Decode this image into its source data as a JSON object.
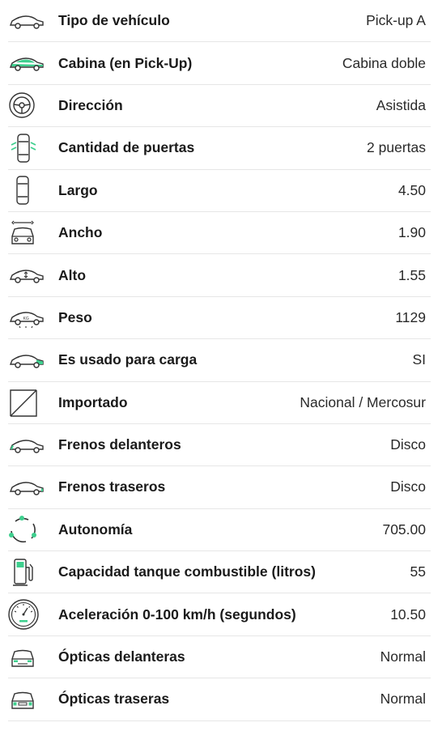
{
  "accent_color": "#3ecf8e",
  "specs": [
    {
      "icon": "car-side-icon",
      "label": "Tipo de vehículo",
      "value": "Pick-up A"
    },
    {
      "icon": "car-cabin-icon",
      "label": "Cabina (en Pick-Up)",
      "value": "Cabina doble"
    },
    {
      "icon": "steering-wheel-icon",
      "label": "Dirección",
      "value": "Asistida"
    },
    {
      "icon": "car-doors-icon",
      "label": "Cantidad de puertas",
      "value": "2 puertas"
    },
    {
      "icon": "car-length-icon",
      "label": "Largo",
      "value": "4.50"
    },
    {
      "icon": "car-width-icon",
      "label": "Ancho",
      "value": "1.90"
    },
    {
      "icon": "car-height-icon",
      "label": "Alto",
      "value": "1.55"
    },
    {
      "icon": "car-weight-icon",
      "label": "Peso",
      "value": "1129"
    },
    {
      "icon": "car-cargo-icon",
      "label": "Es usado para carga",
      "value": "SI"
    },
    {
      "icon": "imported-icon",
      "label": "Importado",
      "value": "Nacional / Mercosur"
    },
    {
      "icon": "front-brakes-icon",
      "label": "Frenos delanteros",
      "value": "Disco"
    },
    {
      "icon": "rear-brakes-icon",
      "label": "Frenos traseros",
      "value": "Disco"
    },
    {
      "icon": "autonomy-icon",
      "label": "Autonomía",
      "value": "705.00"
    },
    {
      "icon": "fuel-pump-icon",
      "label": "Capacidad tanque combustible (litros)",
      "value": "55"
    },
    {
      "icon": "speedometer-icon",
      "label": "Aceleración 0-100 km/h (segundos)",
      "value": "10.50"
    },
    {
      "icon": "front-lights-icon",
      "label": "Ópticas delanteras",
      "value": "Normal"
    },
    {
      "icon": "rear-lights-icon",
      "label": "Ópticas traseras",
      "value": "Normal"
    }
  ]
}
